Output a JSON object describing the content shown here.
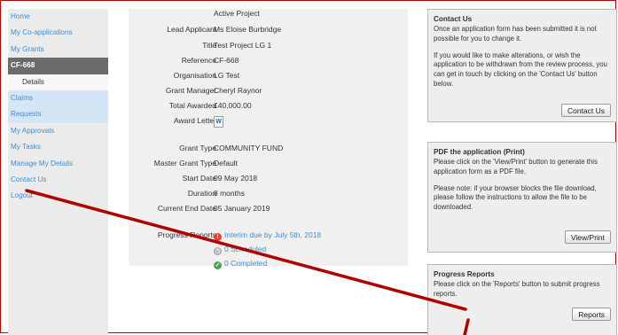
{
  "nav": {
    "items": [
      {
        "label": "Home"
      },
      {
        "label": "My Co-applications"
      },
      {
        "label": "My Grants"
      },
      {
        "label": "CF-668"
      },
      {
        "label": "Details"
      },
      {
        "label": "Claims"
      },
      {
        "label": "Requests"
      },
      {
        "label": "My Approvals"
      },
      {
        "label": "My Tasks"
      },
      {
        "label": "Manage My Details"
      },
      {
        "label": "Contact Us"
      },
      {
        "label": "Logout"
      }
    ]
  },
  "project": {
    "status": "Active Project",
    "fields": [
      {
        "label": "Lead Applicant",
        "value": "Ms Eloise Burbridge"
      },
      {
        "label": "Title",
        "value": "Test Project LG 1"
      },
      {
        "label": "Reference",
        "value": "CF-668"
      },
      {
        "label": "Organisation",
        "value": "LG Test"
      },
      {
        "label": "Grant Manager",
        "value": "Cheryl Raynor"
      },
      {
        "label": "Total Awarded",
        "value": "£40,000.00"
      },
      {
        "label": "Award Letter",
        "value": ""
      },
      {
        "label": "Grant Type",
        "value": "COMMUNITY FUND"
      },
      {
        "label": "Master Grant Type",
        "value": "Default"
      },
      {
        "label": "Start Date",
        "value": "09 May 2018"
      },
      {
        "label": "Duration",
        "value": "8 months"
      },
      {
        "label": "Current End Date",
        "value": "05 January 2019"
      }
    ],
    "award_letter_icon": "word-document-icon",
    "progress": {
      "label": "Progress Reports",
      "items": [
        {
          "text": "Interim due by July 5th, 2018",
          "icon": "warning-icon",
          "color": "#e0442b"
        },
        {
          "text": "0 Scheduled",
          "icon": "clock-icon",
          "color": "#a7a7a7"
        },
        {
          "text": "0 Completed",
          "icon": "check-icon",
          "color": "#46a546"
        }
      ]
    }
  },
  "panels": {
    "contact": {
      "title": "Contact Us",
      "p1": "Once an application form has been submitted it is not possible for you to change it.",
      "p2": "If you would like to make alterations, or wish the application to be withdrawn from the review process, you can get in touch by clicking on the 'Contact Us' button below.",
      "button": "Contact Us"
    },
    "pdf": {
      "title": "PDF the application (Print)",
      "p1": "Please click on the 'View/Print' button to generate this application form as a PDF file.",
      "p2": "Please note: if your browser blocks the file download, please follow the instructions to allow the file to be downloaded.",
      "button": "View/Print"
    },
    "reports": {
      "title": "Progress Reports",
      "p1": "Please click on the 'Reports' button to submit progress reports.",
      "button": "Reports"
    }
  },
  "annotation_color": "#b00000"
}
